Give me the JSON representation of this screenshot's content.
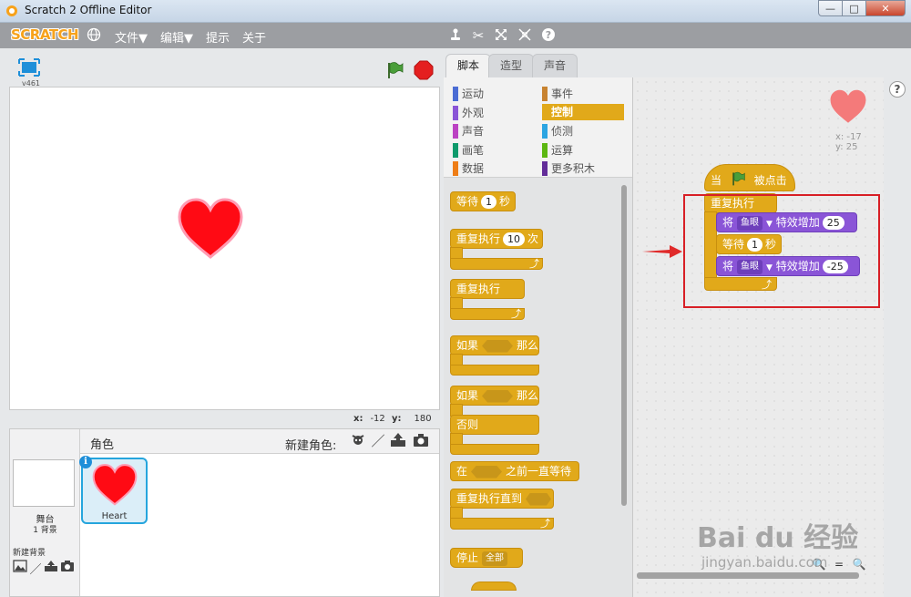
{
  "window": {
    "title": "Scratch 2 Offline Editor"
  },
  "menubar": {
    "logo": "SCRATCH",
    "items": [
      "文件▼",
      "编辑▼",
      "提示",
      "关于"
    ]
  },
  "stage": {
    "version": "v461",
    "mouse_x_label": "x:",
    "mouse_x": "-12",
    "mouse_y_label": "y:",
    "mouse_y": "180"
  },
  "sprites": {
    "title": "角色",
    "new_sprite_label": "新建角色:",
    "stage_label": "舞台",
    "backdrop_count": "1 背景",
    "new_backdrop_label": "新建背景",
    "selected_sprite": "Heart"
  },
  "tabs": [
    "脚本",
    "造型",
    "声音"
  ],
  "categories": [
    {
      "label": "运动",
      "color": "#4a6cd4"
    },
    {
      "label": "事件",
      "color": "#c88330"
    },
    {
      "label": "外观",
      "color": "#8a55d7"
    },
    {
      "label": "控制",
      "color": "#e1a91a"
    },
    {
      "label": "声音",
      "color": "#bb42c3"
    },
    {
      "label": "侦测",
      "color": "#2ca5e2"
    },
    {
      "label": "画笔",
      "color": "#0e9a6c"
    },
    {
      "label": "运算",
      "color": "#5cb712"
    },
    {
      "label": "数据",
      "color": "#ee7d16"
    },
    {
      "label": "更多积木",
      "color": "#632d99"
    }
  ],
  "palette": {
    "wait_label": "等待",
    "wait_value": "1",
    "wait_unit": "秒",
    "repeat_label": "重复执行",
    "repeat_value": "10",
    "repeat_unit": "次",
    "forever_label": "重复执行",
    "if_label": "如果",
    "then_label": "那么",
    "if2_label": "如果",
    "then2_label": "那么",
    "else_label": "否则",
    "wait_until_pre": "在",
    "wait_until_post": "之前一直等待",
    "repeat_until_label": "重复执行直到",
    "stop_label": "停止",
    "stop_option": "全部"
  },
  "script": {
    "hat_pre": "当",
    "hat_post": "被点击",
    "forever": "重复执行",
    "set_label": "将",
    "effect": "鱼眼",
    "change_label": "特效增加",
    "change_value1": "25",
    "wait_label": "等待",
    "wait_value": "1",
    "wait_unit": "秒",
    "change_value2": "-25",
    "sprite_x": "x: -17",
    "sprite_y": "y: 25"
  },
  "watermark": {
    "brand": "Bai du 经验",
    "url": "jingyan.baidu.com"
  }
}
